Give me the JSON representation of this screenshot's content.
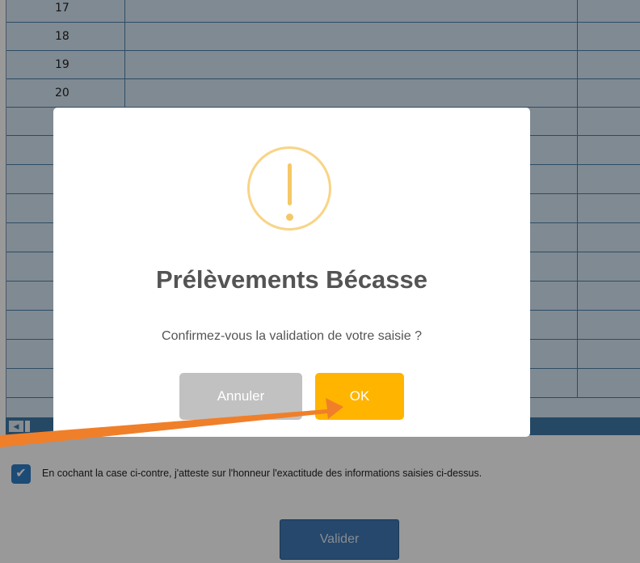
{
  "grid": {
    "rows": [
      {
        "number": "17"
      },
      {
        "number": "18"
      },
      {
        "number": "19"
      },
      {
        "number": "20"
      },
      {
        "number": ""
      },
      {
        "number": ""
      },
      {
        "number": ""
      },
      {
        "number": ""
      },
      {
        "number": ""
      },
      {
        "number": ""
      },
      {
        "number": ""
      },
      {
        "number": ""
      },
      {
        "number": ""
      },
      {
        "number": ""
      }
    ]
  },
  "scrollbar": {
    "left_arrow_icon": "triangle-left-icon"
  },
  "attestation": {
    "checked": true,
    "check_icon": "checkmark-icon",
    "text": "En cochant la case ci-contre, j'atteste sur l'honneur l'exactitude des informations saisies ci-dessus."
  },
  "page_actions": {
    "validate_label": "Valider"
  },
  "dialog": {
    "icon": "warning-exclamation-icon",
    "title": "Prélèvements Bécasse",
    "message": "Confirmez-vous la validation de votre saisie ?",
    "cancel_label": "Annuler",
    "ok_label": "OK"
  },
  "colors": {
    "ok_button": "#ffb400",
    "cancel_button": "#c1c1c1",
    "warning_icon": "#f8d486",
    "annotation_arrow": "#f07f2a",
    "validate_button": "#3f79b5"
  }
}
